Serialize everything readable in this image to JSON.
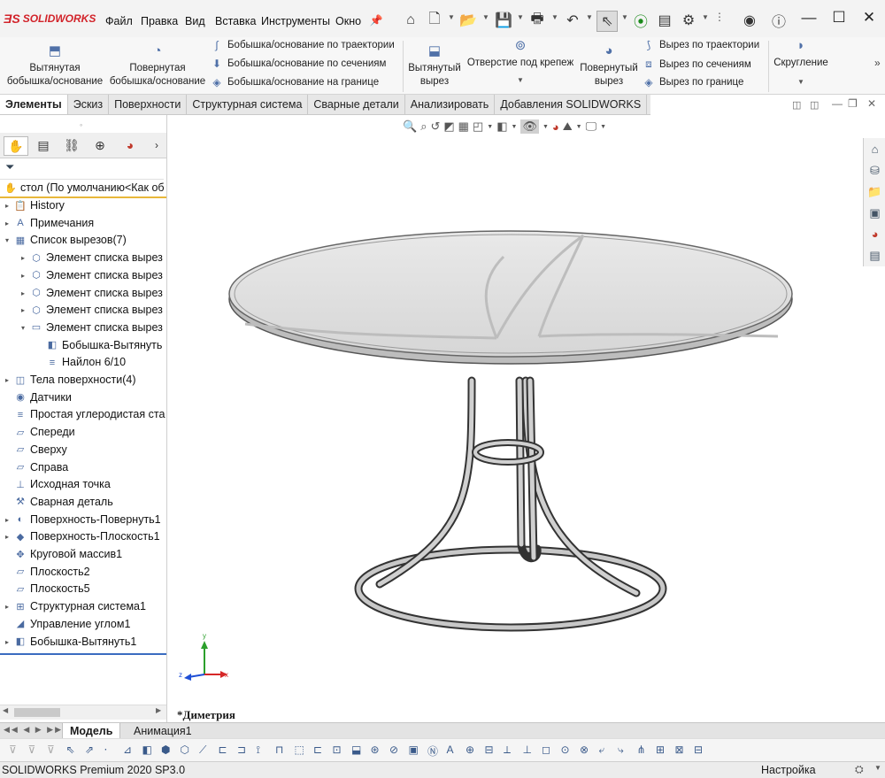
{
  "app": {
    "logo": "SOLIDWORKS"
  },
  "menu": [
    "Файл",
    "Правка",
    "Вид",
    "Вставка",
    "Инструменты",
    "Окно"
  ],
  "ribbon": {
    "extrude_boss": "Вытянутая бобышка/основание",
    "revolve_boss": "Повернутая бобышка/основание",
    "swept_boss": "Бобышка/основание по траектории",
    "loft_boss": "Бобышка/основание по сечениям",
    "boundary_boss": "Бобышка/основание на границе",
    "extrude_cut": "Вытянутый вырез",
    "hole_wizard": "Отверстие под крепеж",
    "revolve_cut": "Повернутый вырез",
    "swept_cut": "Вырез по траектории",
    "loft_cut": "Вырез по сечениям",
    "boundary_cut": "Вырез по границе",
    "fillet": "Скругление"
  },
  "tabs": [
    "Элементы",
    "Эскиз",
    "Поверхности",
    "Структурная система",
    "Сварные детали",
    "Анализировать",
    "Добавления SOLIDWORKS"
  ],
  "tree": {
    "root": "стол  (По умолчанию<Как об",
    "items": [
      {
        "label": "History",
        "level": 0,
        "arrow": "▸",
        "icon": "📋"
      },
      {
        "label": "Примечания",
        "level": 0,
        "arrow": "▸",
        "icon": "A"
      },
      {
        "label": "Список вырезов(7)",
        "level": 0,
        "arrow": "▾",
        "icon": "▦"
      },
      {
        "label": "Элемент списка вырез",
        "level": 1,
        "arrow": "▸",
        "icon": "⬡"
      },
      {
        "label": "Элемент списка вырез",
        "level": 1,
        "arrow": "▸",
        "icon": "⬡"
      },
      {
        "label": "Элемент списка вырез",
        "level": 1,
        "arrow": "▸",
        "icon": "⬡"
      },
      {
        "label": "Элемент списка вырез",
        "level": 1,
        "arrow": "▸",
        "icon": "⬡"
      },
      {
        "label": "Элемент списка вырез",
        "level": 1,
        "arrow": "▾",
        "icon": "▭"
      },
      {
        "label": "Бобышка-Вытянуть",
        "level": 2,
        "arrow": "",
        "icon": "◧"
      },
      {
        "label": "Найлон 6/10",
        "level": 2,
        "arrow": "",
        "icon": "≡"
      },
      {
        "label": "Тела поверхности(4)",
        "level": 0,
        "arrow": "▸",
        "icon": "◫"
      },
      {
        "label": "Датчики",
        "level": 0,
        "arrow": "",
        "icon": "◉"
      },
      {
        "label": "Простая углеродистая ста",
        "level": 0,
        "arrow": "",
        "icon": "≡"
      },
      {
        "label": "Спереди",
        "level": 0,
        "arrow": "",
        "icon": "▱"
      },
      {
        "label": "Сверху",
        "level": 0,
        "arrow": "",
        "icon": "▱"
      },
      {
        "label": "Справа",
        "level": 0,
        "arrow": "",
        "icon": "▱"
      },
      {
        "label": "Исходная точка",
        "level": 0,
        "arrow": "",
        "icon": "⊥"
      },
      {
        "label": "Сварная деталь",
        "level": 0,
        "arrow": "",
        "icon": "⚒"
      },
      {
        "label": "Поверхность-Повернуть1",
        "level": 0,
        "arrow": "▸",
        "icon": "◐"
      },
      {
        "label": "Поверхность-Плоскость1",
        "level": 0,
        "arrow": "▸",
        "icon": "◆"
      },
      {
        "label": "Круговой массив1",
        "level": 0,
        "arrow": "",
        "icon": "✥"
      },
      {
        "label": "Плоскость2",
        "level": 0,
        "arrow": "",
        "icon": "▱"
      },
      {
        "label": "Плоскость5",
        "level": 0,
        "arrow": "",
        "icon": "▱"
      },
      {
        "label": "Структурная система1",
        "level": 0,
        "arrow": "▸",
        "icon": "⊞"
      },
      {
        "label": "Управление углом1",
        "level": 0,
        "arrow": "",
        "icon": "◢"
      },
      {
        "label": "Бобышка-Вытянуть1",
        "level": 0,
        "arrow": "▸",
        "icon": "◧"
      }
    ]
  },
  "viewport": {
    "view_name": "*Диметрия"
  },
  "triad": {
    "x": "x",
    "y": "y",
    "z": "z"
  },
  "bottom_tabs": [
    "Модель",
    "Анимация1"
  ],
  "status": {
    "left": "SOLIDWORKS Premium 2020 SP3.0",
    "right": "Настройка"
  }
}
